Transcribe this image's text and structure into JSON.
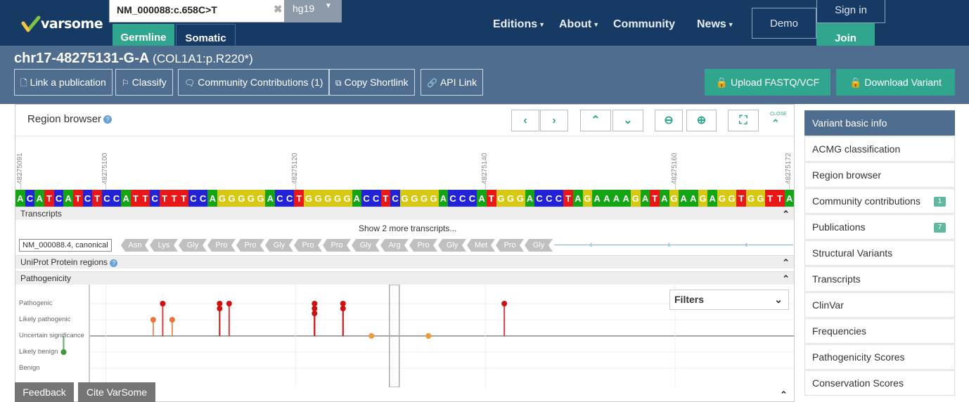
{
  "header": {
    "logo_text": "varsome",
    "search": {
      "value": "NM_000088:c.658C>T",
      "clear": "✖"
    },
    "genome": "hg19",
    "tabs": [
      "Germline",
      "Somatic"
    ],
    "nav": [
      "Editions",
      "About",
      "Community",
      "News"
    ],
    "demo": "Demo",
    "signin": "Sign in",
    "join": "Join"
  },
  "variant": {
    "title": "chr17-48275131-G-A",
    "protein": "(COL1A1:p.R220*)"
  },
  "toolbar": {
    "buttons": [
      "Link a publication",
      "Classify",
      "Community Contributions (1)",
      "Copy Shortlink",
      "API Link"
    ],
    "upload": "Upload FASTQ/VCF",
    "download": "Download Variant"
  },
  "region": {
    "title": "Region browser",
    "close": "CLOSE",
    "ticks": [
      "48275091",
      "48275100",
      "48275120",
      "48275140",
      "48275160",
      "48275172"
    ],
    "sequence": "ACATCATCTCCATTCTTTCCAGGGGGACCTGGGGGACCTCGGGGACCCATGGGACCCTAGAAAAGATAGAAGAGGTGGTTA",
    "sections": [
      "Transcripts",
      "UniProt Protein regions",
      "Pathogenicity"
    ],
    "more_transcripts": "Show 2 more transcripts...",
    "transcript_label": "NM_000088.4, canonical",
    "amino_acids": [
      "Asn",
      "Lys",
      "Gly",
      "Pro",
      "Pro",
      "Gly",
      "Pro",
      "Pro",
      "Gly",
      "Arg",
      "Pro",
      "Gly",
      "Met",
      "Pro",
      "Gly"
    ],
    "pathogenicity_levels": [
      "Pathogenic",
      "Likely pathogenic",
      "Uncertain significance",
      "Likely benign",
      "Benign"
    ],
    "filters": "Filters"
  },
  "pathogenicity_marks": [
    {
      "pos": 48275096,
      "level": "Likely benign",
      "color": "#3a9a3a"
    },
    {
      "pos": 48275105,
      "level": "Likely pathogenic",
      "color": "#e8743a"
    },
    {
      "pos": 48275106,
      "level": "Pathogenic",
      "color": "#cc1111"
    },
    {
      "pos": 48275107,
      "level": "Likely pathogenic",
      "color": "#e8743a"
    },
    {
      "pos": 48275112,
      "level": "Pathogenic",
      "color": "#cc1111"
    },
    {
      "pos": 48275112,
      "level": "Pathogenic",
      "color": "#cc1111"
    },
    {
      "pos": 48275113,
      "level": "Pathogenic",
      "color": "#cc1111"
    },
    {
      "pos": 48275122,
      "level": "Pathogenic",
      "color": "#cc1111"
    },
    {
      "pos": 48275122,
      "level": "Pathogenic",
      "color": "#cc1111"
    },
    {
      "pos": 48275122,
      "level": "Pathogenic",
      "color": "#cc1111"
    },
    {
      "pos": 48275125,
      "level": "Pathogenic",
      "color": "#cc1111"
    },
    {
      "pos": 48275125,
      "level": "Pathogenic",
      "color": "#cc1111"
    },
    {
      "pos": 48275128,
      "level": "Uncertain significance",
      "color": "#ee9a3a"
    },
    {
      "pos": 48275134,
      "level": "Uncertain significance",
      "color": "#ee9a3a"
    },
    {
      "pos": 48275142,
      "level": "Pathogenic",
      "color": "#cc1111"
    }
  ],
  "footer": {
    "feedback": "Feedback",
    "cite": "Cite VarSome"
  },
  "sidebar": {
    "items": [
      {
        "label": "Variant basic info",
        "badge": ""
      },
      {
        "label": "ACMG classification",
        "badge": ""
      },
      {
        "label": "Region browser",
        "badge": ""
      },
      {
        "label": "Community contributions",
        "badge": "1"
      },
      {
        "label": "Publications",
        "badge": "7"
      },
      {
        "label": "Structural Variants",
        "badge": ""
      },
      {
        "label": "Transcripts",
        "badge": ""
      },
      {
        "label": "ClinVar",
        "badge": ""
      },
      {
        "label": "Frequencies",
        "badge": ""
      },
      {
        "label": "Pathogenicity Scores",
        "badge": ""
      },
      {
        "label": "Conservation Scores",
        "badge": ""
      }
    ]
  },
  "colors": {
    "navy": "#163a63",
    "teal": "#31a68e",
    "slate": "#4f6d8f"
  }
}
